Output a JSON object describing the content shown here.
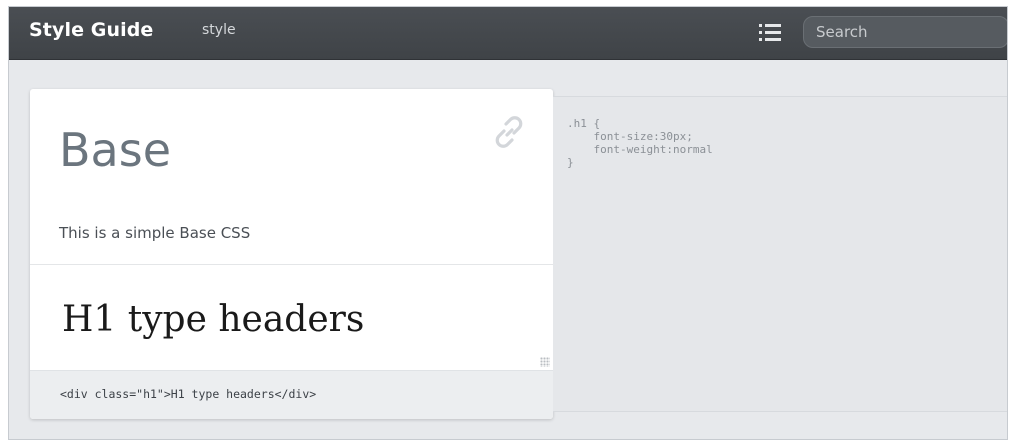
{
  "header": {
    "brand": "Style Guide",
    "subtitle": "style",
    "search_placeholder": "Search"
  },
  "section": {
    "title": "Base",
    "description": "This is a simple Base CSS",
    "example_text": "H1 type headers",
    "markup_snippet": "<div class=\"h1\">H1 type headers</div>"
  },
  "css_panel": {
    "code": ".h1 {\n    font-size:30px;\n    font-weight:normal\n}"
  },
  "icons": {
    "menu": "list-menu-icon",
    "permalink": "link-icon"
  },
  "colors": {
    "topbar": "#45494e",
    "page_bg": "#e7e9ec",
    "card_bg": "#ffffff",
    "title_text": "#6b757e",
    "code_text": "#8b9096"
  }
}
